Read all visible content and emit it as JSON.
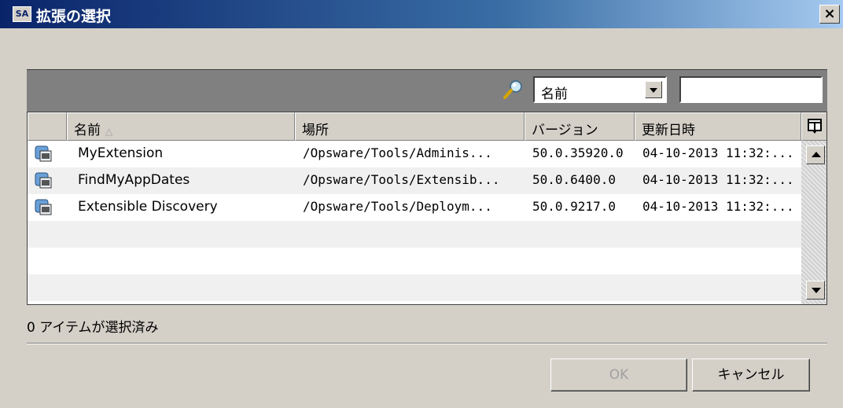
{
  "window": {
    "icon_text": "SA",
    "title": "拡張の選択",
    "close_label": "×"
  },
  "filter": {
    "field_value": "名前",
    "search_value": ""
  },
  "table": {
    "columns": [
      "名前",
      "場所",
      "バージョン",
      "更新日時"
    ],
    "sort_indicator": "△",
    "rows": [
      {
        "name": "MyExtension",
        "location": "/Opsware/Tools/Adminis...",
        "version": "50.0.35920.0",
        "updated": "04-10-2013 11:32:..."
      },
      {
        "name": "FindMyAppDates",
        "location": "/Opsware/Tools/Extensib...",
        "version": "50.0.6400.0",
        "updated": "04-10-2013 11:32:..."
      },
      {
        "name": "Extensible Discovery",
        "location": "/Opsware/Tools/Deploym...",
        "version": "50.0.9217.0",
        "updated": "04-10-2013 11:32:..."
      }
    ]
  },
  "status": {
    "text": "0 アイテムが選択済み"
  },
  "buttons": {
    "ok": "OK",
    "cancel": "キャンセル"
  }
}
